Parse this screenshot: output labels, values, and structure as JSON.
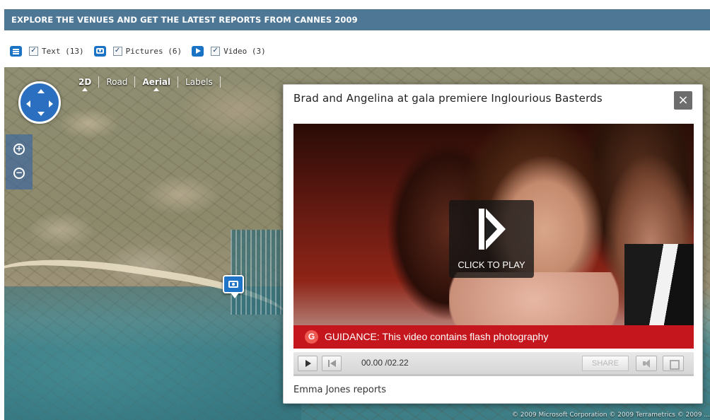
{
  "banner": {
    "title": "EXPLORE THE VENUES AND GET THE LATEST REPORTS FROM CANNES 2009"
  },
  "filters": [
    {
      "icon": "text-icon",
      "checked": true,
      "label": "Text (13)"
    },
    {
      "icon": "camera-icon",
      "checked": true,
      "label": "Pictures (6)"
    },
    {
      "icon": "video-icon",
      "checked": true,
      "label": "Video (3)"
    }
  ],
  "map": {
    "toolbar": [
      "2D",
      "Road",
      "Aerial",
      "Labels"
    ],
    "selected_view": "Aerial",
    "copyright": "© 2009 Microsoft Corporation   © 2009 Terrametrics   © 2009 ..."
  },
  "popup": {
    "title": "Brad and Angelina at gala premiere Inglourious Basterds",
    "close_label": "×",
    "play_overlay_label": "CLICK TO PLAY",
    "guidance_badge": "G",
    "guidance_text": "GUIDANCE:  This video contains flash photography",
    "time_display": "00.00 /02.22",
    "share_label": "SHARE",
    "caption": "Emma Jones reports"
  }
}
